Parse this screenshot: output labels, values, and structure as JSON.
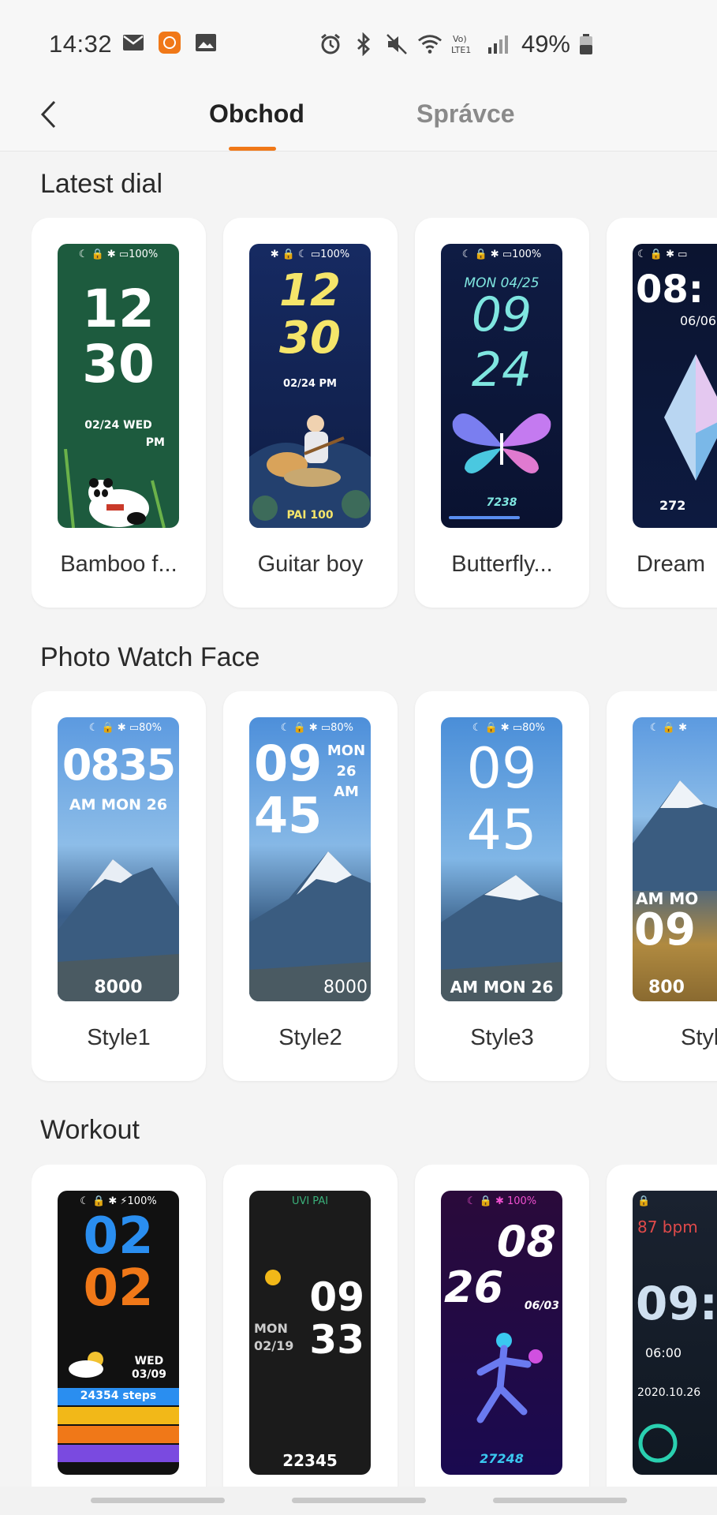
{
  "status_bar": {
    "time": "14:32",
    "battery": "49%",
    "left_icons": [
      "mail-icon",
      "app-notification-icon",
      "image-icon"
    ],
    "right_icons": [
      "alarm-icon",
      "bluetooth-icon",
      "mute-icon",
      "wifi-icon",
      "volte-icon",
      "signal-icon",
      "battery-icon"
    ]
  },
  "header": {
    "back_icon": "chevron-left-icon",
    "tabs": [
      {
        "label": "Obchod",
        "active": true
      },
      {
        "label": "Správce",
        "active": false
      }
    ],
    "accent": "#f07818"
  },
  "sections": [
    {
      "title": "Latest dial",
      "items": [
        {
          "label": "Bamboo f...",
          "face": {
            "bg": "#1d5b3e",
            "status": "☾ 🔒 ✱ ▭100%",
            "time_top": "12",
            "time_bottom": "30",
            "sub1": "02/24 WED",
            "sub2": "PM",
            "fg": "#ffffff"
          }
        },
        {
          "label": "Guitar boy",
          "face": {
            "bg": "#1a2a5a",
            "status": "✱ 🔒 ☾ ▭100%",
            "time_top": "12",
            "time_bottom": "30",
            "sub1": "02/24  PM",
            "sub2": "PAI  100",
            "fg": "#f5e56a"
          }
        },
        {
          "label": "Butterfly...",
          "face": {
            "bg": "#101a3a",
            "status": "☾ 🔒 ✱ ▭100%",
            "time_top": "09",
            "time_bottom": "24",
            "sub1": "MON 04/25",
            "sub2": "7238",
            "fg": "#7fe6e0"
          }
        },
        {
          "label": "Dream",
          "face": {
            "bg": "#0b1430",
            "status": "☾ 🔒 ✱ ▭",
            "time_top": "08:",
            "time_bottom": "",
            "sub1": "06/06",
            "sub2": "272",
            "fg": "#ffffff"
          }
        }
      ]
    },
    {
      "title": "Photo Watch Face",
      "items": [
        {
          "label": "Style1",
          "face": {
            "bg": "#5a8fcf",
            "status": "☾ 🔒 ✱ ▭80%",
            "time_top": "0835",
            "time_bottom": "",
            "sub1": "AM MON 26",
            "sub2": "8000",
            "fg": "#ffffff"
          }
        },
        {
          "label": "Style2",
          "face": {
            "bg": "#4f8ed6",
            "status": "☾ 🔒 ✱ ▭80%",
            "time_top": "09",
            "time_bottom": "45",
            "sub1": "MON 26 AM",
            "sub2": "8000",
            "fg": "#ffffff"
          }
        },
        {
          "label": "Style3",
          "face": {
            "bg": "#4d91da",
            "status": "☾ 🔒 ✱ ▭80%",
            "time_top": "09",
            "time_bottom": "45",
            "sub1": "",
            "sub2": "AM MON 26",
            "fg": "#ffffff"
          }
        },
        {
          "label": "Styl",
          "face": {
            "bg": "#6aa0d6",
            "status": "☾ 🔒 ✱",
            "time_top": "",
            "time_bottom": "09",
            "sub1": "AM MO",
            "sub2": "800",
            "fg": "#ffffff"
          }
        }
      ]
    },
    {
      "title": "Workout",
      "items": [
        {
          "label": "",
          "face": {
            "bg": "#111111",
            "status": "☾ 🔒 ✱ ⚡100%",
            "time_top": "02",
            "time_bottom": "02",
            "sub1": "WED 03/09",
            "sub2": "24354 steps",
            "fg": "#2a8ef0"
          }
        },
        {
          "label": "",
          "face": {
            "bg": "#1b1b1b",
            "status": "UVI  PAI",
            "time_top": "09",
            "time_bottom": "33",
            "sub1": "MON 02/19",
            "sub2": "22345",
            "fg": "#ffffff"
          }
        },
        {
          "label": "",
          "face": {
            "bg": "#2a0a3a",
            "status": "☾ 🔒 ✱ 100%",
            "time_top": "08",
            "time_bottom": "26",
            "sub1": "06/03",
            "sub2": "27248",
            "fg": "#ffffff"
          }
        },
        {
          "label": "",
          "face": {
            "bg": "#1a2230",
            "status": "🔒",
            "time_top": "87 bpm",
            "time_bottom": "09:",
            "sub1": "06:00",
            "sub2": "2020.10.26",
            "fg": "#ffffff"
          }
        }
      ]
    }
  ]
}
